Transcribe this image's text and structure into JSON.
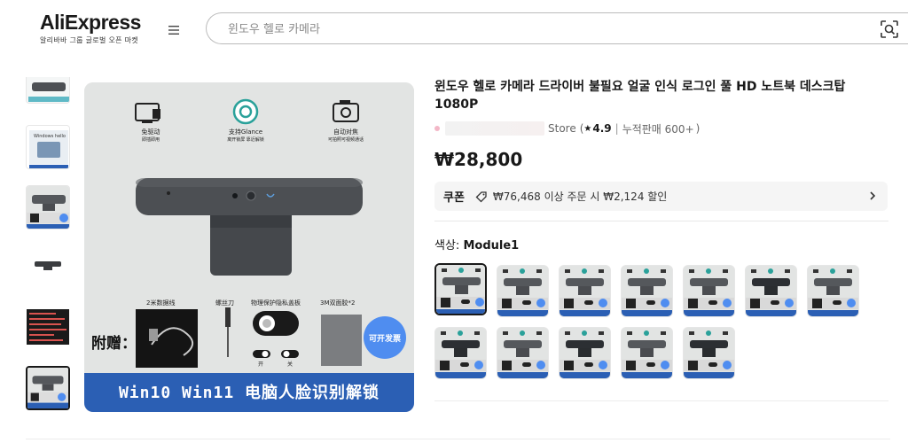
{
  "header": {
    "logo": "AliExpress",
    "logo_sub": "알리바바 그룹 글로벌 오픈 마켓",
    "search_placeholder": "윈도우 헬로 카메라"
  },
  "product": {
    "title": "윈도우 헬로 카메라 드라이버 불필요 얼굴 인식 로그인 풀 HD 노트북 데스크탑 1080P",
    "store_suffix": "Store",
    "rating": "4.9",
    "sold": "누적판매 600+",
    "price": "₩28,800",
    "coupon_label": "쿠폰",
    "coupon_text": "₩76,468 이상 주문 시 ₩2,124 할인",
    "color_label": "색상:",
    "color_value": "Module1"
  },
  "main_image": {
    "icon1_title": "免驱动",
    "icon1_sub": "即插即用",
    "icon2_title": "支持Glance",
    "icon2_sub": "离开锁屏 靠近解锁",
    "icon3_title": "自动对焦",
    "icon3_sub": "可拍照可视频通话",
    "acc1": "2米数据线",
    "acc2": "螺丝刀",
    "acc3": "物理保护隐私盖板",
    "acc4": "3M双面胶*2",
    "gift_label": "附赠：",
    "switch_open": "开",
    "switch_close": "关",
    "badge": "可开发票",
    "banner": "Win10 Win11 电脑人脸识别解锁"
  },
  "colors": {
    "brand": "#191919",
    "banner": "#2b5fb4",
    "badge": "#4f8df0"
  }
}
